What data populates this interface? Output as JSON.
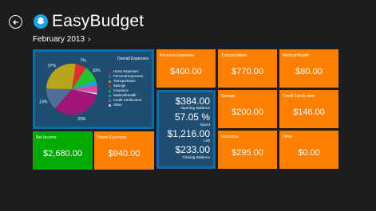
{
  "header": {
    "title": "EasyBudget",
    "period": "February 2013",
    "period_chevron": "›"
  },
  "tiles": {
    "net_income": {
      "label": "Net Income",
      "value": "$2,680.00"
    },
    "home_expenses": {
      "label": "Home Expenses",
      "value": "$940.00"
    },
    "personal_expenses": {
      "label": "Personal Expenses",
      "value": "$400.00"
    },
    "transportation": {
      "label": "Transportation",
      "value": "$770.00"
    },
    "medical_health": {
      "label": "Medical/Health",
      "value": "$80.00"
    },
    "savings": {
      "label": "Savings",
      "value": "$200.00"
    },
    "credit_card_loans": {
      "label": "Credit Card/Loans",
      "value": "$146.00"
    },
    "insurance": {
      "label": "Insurance",
      "value": "$295.00"
    },
    "other": {
      "label": "Other",
      "value": "$0.00"
    }
  },
  "summary": {
    "opening_balance_value": "$384.00",
    "opening_balance_label": "Opening Balance",
    "spent_pct": "57.05 %",
    "spent_label": "Spent",
    "left_value": "$1,216.00",
    "left_label": "Left",
    "closing_balance_value": "$233.00",
    "closing_balance_label": "Closing Balance"
  },
  "chart_data": {
    "type": "pie",
    "title": "Overall Expenses",
    "categories": [
      "Home Expenses",
      "Personal Expenses",
      "Transportation",
      "Savings",
      "Insurance",
      "Medical/Health",
      "Credit Card/Loans",
      "Other"
    ],
    "values": [
      33,
      14,
      27,
      7,
      10,
      3,
      5,
      1
    ],
    "labels": [
      "33%",
      "14%",
      "27%",
      "7%",
      "10%",
      "",
      "",
      ""
    ],
    "colors": [
      "#a0167a",
      "#4e6f95",
      "#b7a51c",
      "#e22d2d",
      "#22c531",
      "#16a9d8",
      "#d64aa8",
      "#d9d9d9"
    ]
  },
  "colors": {
    "orange": "#ff7f00",
    "green": "#00aa00",
    "blue": "#0e6ca8",
    "background": "#1d1d1d"
  },
  "icons": {
    "back": "back-arrow-icon",
    "logo": "easybudget-logo-icon"
  }
}
